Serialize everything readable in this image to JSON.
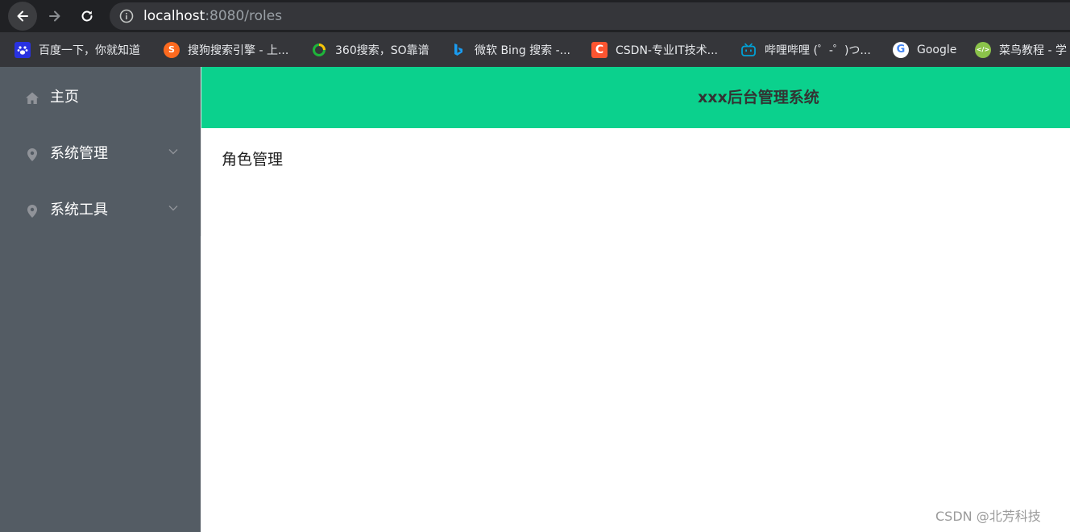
{
  "browser": {
    "url_host": "localhost",
    "url_rest": ":8080/roles",
    "bookmarks": [
      {
        "label": "百度一下，你就知道",
        "icon": "baidu-paw-icon",
        "color": "#2932e1"
      },
      {
        "label": "搜狗搜索引擎 - 上...",
        "icon": "sogou-icon",
        "color": "#fd6a1f"
      },
      {
        "label": "360搜索，SO靠谱",
        "icon": "360-search-icon",
        "color": "#1fb53a"
      },
      {
        "label": "微软 Bing 搜索 -...",
        "icon": "bing-icon",
        "color": "#1a9cf0"
      },
      {
        "label": "CSDN-专业IT技术...",
        "icon": "csdn-icon",
        "color": "#fc5531"
      },
      {
        "label": "哔哩哔哩 (゜-゜)つ...",
        "icon": "bilibili-icon",
        "color": "#00a1d6"
      },
      {
        "label": "Google",
        "icon": "google-icon",
        "color": "#4285f4"
      },
      {
        "label": "菜鸟教程 - 学",
        "icon": "runoob-icon",
        "color": "#8bc34a"
      }
    ]
  },
  "sidebar": {
    "items": [
      {
        "label": "主页",
        "icon": "home-icon",
        "expandable": false
      },
      {
        "label": "系统管理",
        "icon": "location-pin-icon",
        "expandable": true
      },
      {
        "label": "系统工具",
        "icon": "location-pin-icon",
        "expandable": true
      }
    ]
  },
  "header": {
    "title": "xxx后台管理系统"
  },
  "main": {
    "page_text": "角色管理"
  },
  "watermark": "CSDN @北芳科技",
  "colors": {
    "sidebar_bg": "#545c64",
    "header_bg": "#0bd18d",
    "chrome_bg": "#202124"
  }
}
